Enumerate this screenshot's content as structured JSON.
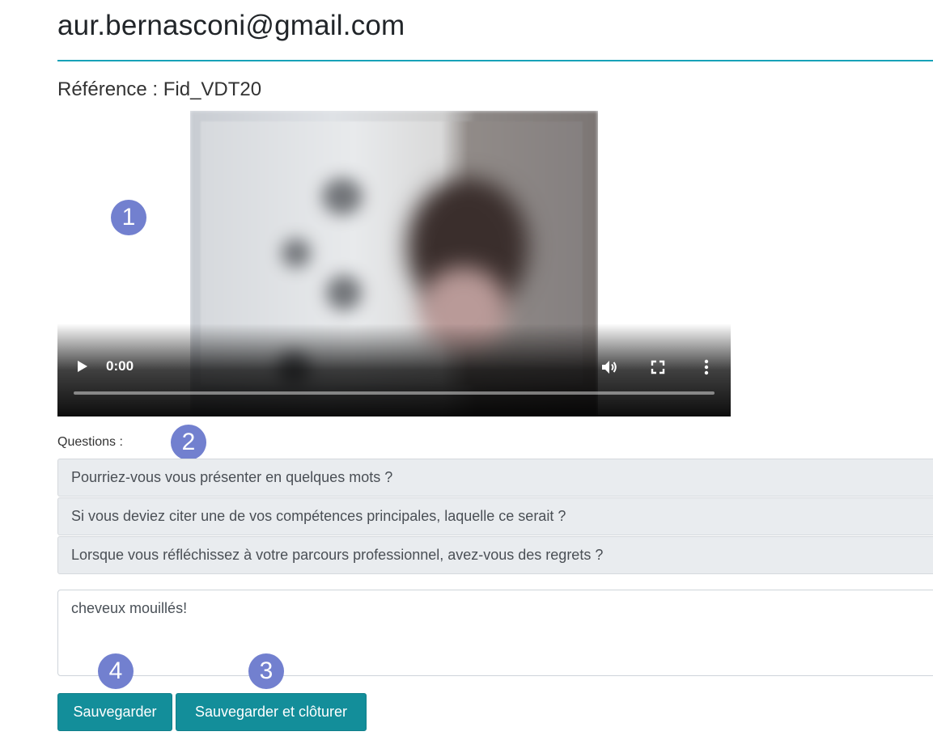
{
  "header": {
    "email": "aur.bernasconi@gmail.com",
    "reference": "Référence : Fid_VDT20"
  },
  "video": {
    "current_time": "0:00",
    "progress": 0,
    "icons": {
      "play": "play-icon",
      "volume": "volume-icon",
      "fullscreen": "fullscreen-icon",
      "more": "more-vertical-icon"
    }
  },
  "badges": {
    "one": "1",
    "two": "2",
    "three": "3",
    "four": "4"
  },
  "questions": {
    "label": "Questions :",
    "items": [
      "Pourriez-vous vous présenter en quelques mots ?",
      "Si vous deviez citer une de vos compétences principales, laquelle ce serait ?",
      "Lorsque vous réfléchissez à votre parcours professionnel, avez-vous des regrets ?"
    ]
  },
  "comment": {
    "value": "cheveux mouillés!"
  },
  "actions": {
    "save_label": "Sauvegarder",
    "save_close_label": "Sauvegarder et clôturer"
  },
  "colors": {
    "accent": "#17a2b8",
    "button": "#138e9a",
    "badge": "#7280cf",
    "question_bg": "#e9ecef"
  }
}
